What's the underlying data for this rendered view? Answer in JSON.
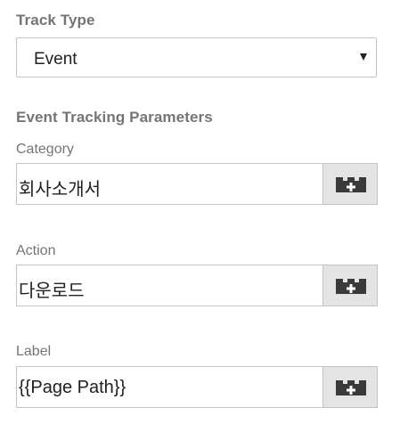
{
  "track_type": {
    "label": "Track Type",
    "selected": "Event"
  },
  "event_params": {
    "heading": "Event Tracking Parameters",
    "fields": [
      {
        "label": "Category",
        "value": "회사소개서",
        "button_icon": "add-variable-icon"
      },
      {
        "label": "Action",
        "value": "다운로드",
        "button_icon": "add-variable-icon"
      },
      {
        "label": "Label",
        "value": "{{Page Path}}",
        "button_icon": "add-variable-icon"
      }
    ]
  }
}
